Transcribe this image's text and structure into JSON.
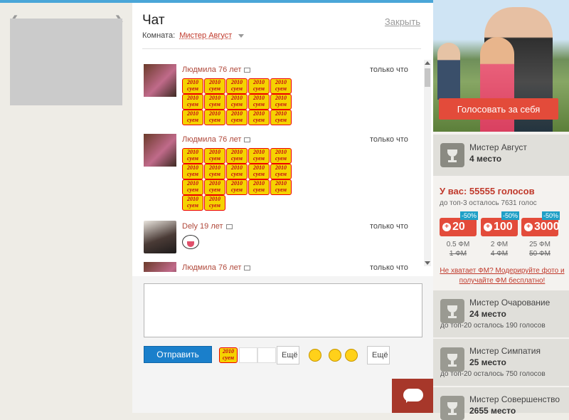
{
  "chat": {
    "title": "Чат",
    "close_label": "Закрыть",
    "room_label": "Комната:",
    "room_name": "Мистер Август",
    "messages": [
      {
        "author": "Людмила 76 лет",
        "time": "только что"
      },
      {
        "author": "Людмила 76 лет",
        "time": "только что"
      },
      {
        "author": "Dely 19 лет",
        "time": "только что"
      },
      {
        "author": "Людмила 76 лет",
        "time": "только что"
      }
    ],
    "sticker_text": "2010 суем",
    "send_label": "Отправить",
    "more_label": "Ещё",
    "input_placeholder": ""
  },
  "sidebar": {
    "vote_self_label": "Голосовать за себя",
    "main_place": {
      "name": "Мистер Август",
      "rank": "4 место"
    },
    "votes": {
      "title": "У вас: 55555 голосов",
      "subtitle": "до топ-3 осталось 7631 голос",
      "options": [
        {
          "plus": "+",
          "amount": "20",
          "discount": "-50%",
          "price": "0.5 ФМ",
          "old_price": "1 ФМ"
        },
        {
          "plus": "+",
          "amount": "100",
          "discount": "-50%",
          "price": "2 ФМ",
          "old_price": "4 ФМ"
        },
        {
          "plus": "+",
          "amount": "3000",
          "discount": "-50%",
          "price": "25 ФМ",
          "old_price": "50 ФМ"
        }
      ],
      "link": "Не хватает ФМ? Модерируйте фото и получайте ФМ бесплатно!"
    },
    "categories": [
      {
        "name": "Мистер Очарование",
        "rank": "24 место",
        "note": "до топ-20 осталось 190 голосов"
      },
      {
        "name": "Мистер Симпатия",
        "rank": "25 место",
        "note": "до топ-20 осталось 750 голосов"
      },
      {
        "name": "Мистер Совершенство",
        "rank": "2655 место",
        "note": ""
      }
    ]
  }
}
